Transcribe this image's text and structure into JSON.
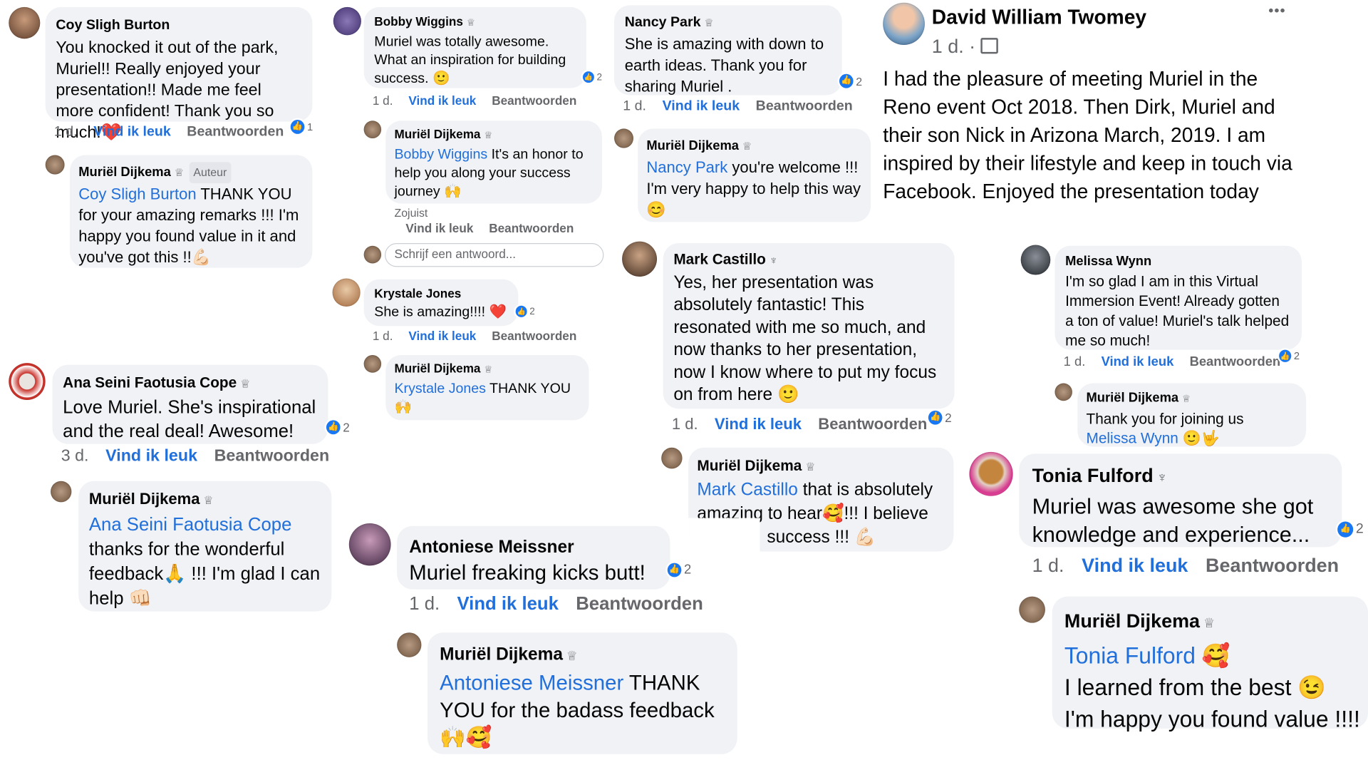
{
  "common": {
    "like": "Vind ik leuk",
    "reply": "Beantwoorden",
    "author_tag": "Auteur",
    "badge": "♕",
    "flower": "♆"
  },
  "colors": {
    "bubble": "#f0f2f5",
    "link": "#216fdb",
    "meta": "#65676b",
    "like_blue": "#1877f2"
  },
  "icons": {
    "like": "thumbs-up-icon",
    "more": "more-options-icon",
    "audience": "audience-icon"
  },
  "comments": [
    {
      "id": "c1",
      "name": "Coy Sligh Burton",
      "text": "You knocked it out of the park, Muriel!! Really enjoyed your presentation!! Made me feel more confident! Thank you so much!❤️",
      "age": "1 d.",
      "reactions": "1"
    },
    {
      "id": "r1",
      "name": "Muriël Dijkema",
      "tag": "Auteur",
      "mention": "Coy Sligh Burton",
      "text": " THANK YOU for your amazing remarks !!! I'm happy you found value in it and you've got this !!💪🏻"
    },
    {
      "id": "c2",
      "name": "Bobby Wiggins",
      "text": "Muriel was totally awesome. What an inspiration for building success. 🙂",
      "age": "1 d.",
      "reactions": "2"
    },
    {
      "id": "r2",
      "name": "Muriël Dijkema",
      "mention": "Bobby Wiggins",
      "text": " It's an honor to help you along your success journey 🙌",
      "age": "Zojuist"
    },
    {
      "id": "w1",
      "placeholder": "Schrijf een antwoord..."
    },
    {
      "id": "c3",
      "name": "Krystale Jones",
      "text": "She is amazing!!!! ❤️",
      "age": "1 d.",
      "reactions": "2"
    },
    {
      "id": "r3",
      "name": "Muriël Dijkema",
      "mention": "Krystale Jones",
      "text": " THANK YOU 🙌"
    },
    {
      "id": "c4",
      "name": "Nancy Park",
      "text": "She is amazing with down to earth ideas. Thank you for sharing Muriel .",
      "age": "1 d.",
      "reactions": "2"
    },
    {
      "id": "r4",
      "name": "Muriël Dijkema",
      "mention": "Nancy Park",
      "text": " you're welcome !!! I'm very happy to help this way 😊"
    },
    {
      "id": "c5",
      "name": "Ana Seini Faotusia Cope",
      "text": "Love Muriel. She's inspirational and the real deal! Awesome!",
      "age": "3 d.",
      "reactions": "2"
    },
    {
      "id": "r5",
      "name": "Muriël Dijkema",
      "mention": "Ana Seini Faotusia Cope",
      "text": " thanks for the wonderful feedback🙏 !!! I'm glad I can help 👊🏻"
    },
    {
      "id": "c6",
      "name": "Antoniese Meissner",
      "text": "Muriel freaking kicks butt!",
      "age": "1 d.",
      "reactions": "2"
    },
    {
      "id": "r6",
      "name": "Muriël Dijkema",
      "mention": "Antoniese Meissner",
      "text": " THANK YOU for the badass feedback 🙌🥰"
    },
    {
      "id": "c7",
      "name": "Mark Castillo",
      "text": "Yes, her presentation was absolutely fantastic! This resonated with me so much, and now thanks to her presentation, now I know where to put my focus on from here 🙂",
      "age": "1 d.",
      "reactions": "2"
    },
    {
      "id": "r7",
      "name": "Muriël Dijkema",
      "mention": "Mark Castillo",
      "text": " that is absolutely amazing to hear🥰!!! I believe",
      "text2": "success !!! 💪🏻"
    },
    {
      "id": "c8",
      "name": "Melissa Wynn",
      "text": "I'm so glad I am in this Virtual Immersion Event! Already gotten a ton of value! Muriel's talk helped me so much!",
      "age": "1 d.",
      "reactions": "2"
    },
    {
      "id": "r8",
      "name": "Muriël Dijkema",
      "text": "Thank you for joining us ",
      "mention": "Melissa Wynn",
      "text2": " 🙂🤟"
    },
    {
      "id": "c9",
      "name": "Tonia Fulford",
      "text": "Muriel was awesome she got knowledge and experience...",
      "age": "1 d.",
      "reactions": "2"
    },
    {
      "id": "r9",
      "name": "Muriël Dijkema",
      "mention": "Tonia Fulford",
      "text": " 🥰",
      "line2": "I learned from the best 😉",
      "line3": "I'm happy you found value !!!!"
    }
  ],
  "post": {
    "name": "David William Twomey",
    "age": "1 d. ·",
    "text": "I had the pleasure of meeting Muriel in the Reno event Oct 2018. Then Dirk, Muriel and their son Nick in Arizona March, 2019. I am inspired by their lifestyle and keep in touch via Facebook. Enjoyed the presentation today",
    "more": "•••"
  }
}
